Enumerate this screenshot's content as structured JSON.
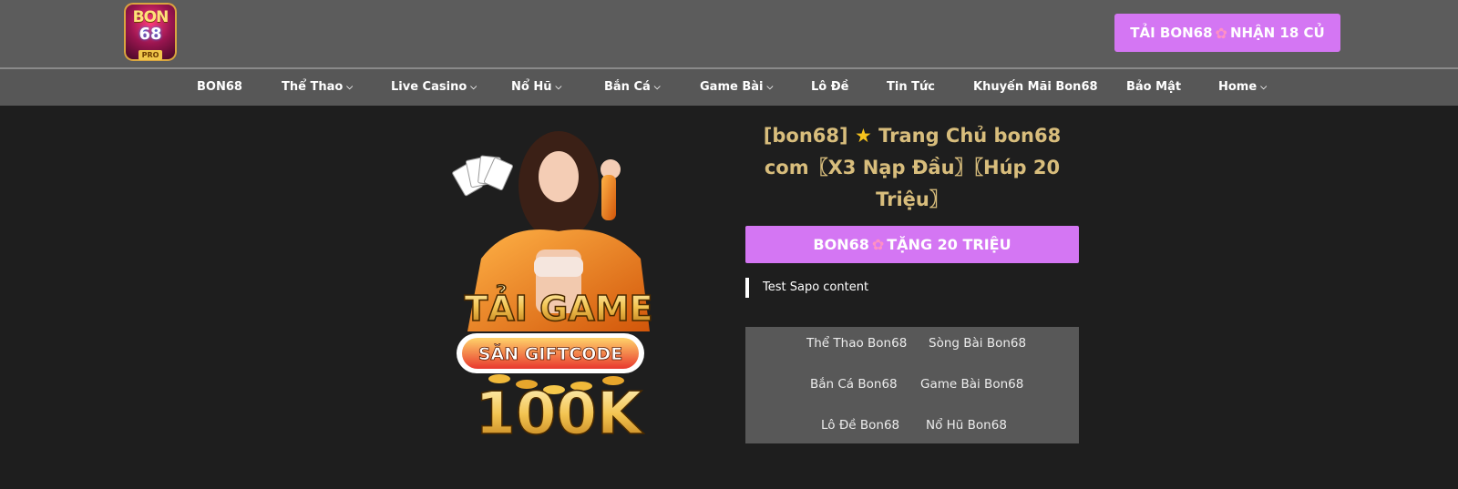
{
  "header": {
    "logo": {
      "top_text": "BON",
      "number": "68",
      "tag": "PRO"
    },
    "download_cta": {
      "left": "TẢI BON68",
      "right": "NHẬN 18 CỦ"
    }
  },
  "nav": {
    "items": [
      {
        "label": "BON68",
        "dropdown": false
      },
      {
        "label": "Thể Thao",
        "dropdown": true
      },
      {
        "label": "Live Casino",
        "dropdown": true
      },
      {
        "label": "Nổ Hũ",
        "dropdown": true
      },
      {
        "label": "Bắn Cá",
        "dropdown": true
      },
      {
        "label": "Game Bài",
        "dropdown": true
      },
      {
        "label": "Lô Đề",
        "dropdown": false
      },
      {
        "label": "Tin Tức",
        "dropdown": false
      },
      {
        "label": "Khuyến Mãi Bon68",
        "dropdown": false
      },
      {
        "label": "Bảo Mật",
        "dropdown": false
      },
      {
        "label": "Home",
        "dropdown": true
      }
    ]
  },
  "hero": {
    "banner": {
      "line1": "TẢI GAME",
      "badge": "SĂN GIFTCODE",
      "amount": "100K"
    },
    "title": {
      "line1_a": "[bon68]",
      "line1_b": "Trang Chủ bon68",
      "line2": "com〖X3 Nạp Đầu〗〖Húp 20",
      "line3": "Triệu〗"
    },
    "main_cta": {
      "left": "BON68",
      "right": "TẶNG 20 TRIỆU"
    },
    "sapo": "Test Sapo content",
    "links": [
      "Thể Thao Bon68",
      "Sòng Bài Bon68",
      "Bắn Cá Bon68",
      "Game Bài Bon68",
      "Lô Đề Bon68",
      "Nổ Hũ Bon68"
    ]
  },
  "colors": {
    "header_bg": "#5c5c5c",
    "nav_bg": "#575757",
    "page_bg": "#1e1e1e",
    "accent": "#d476f3",
    "title": "#d8bd7c",
    "links_bg": "#585858"
  },
  "icons": {
    "chevron": "chevron-down-icon",
    "flower": "flower-icon",
    "star": "star-icon"
  }
}
